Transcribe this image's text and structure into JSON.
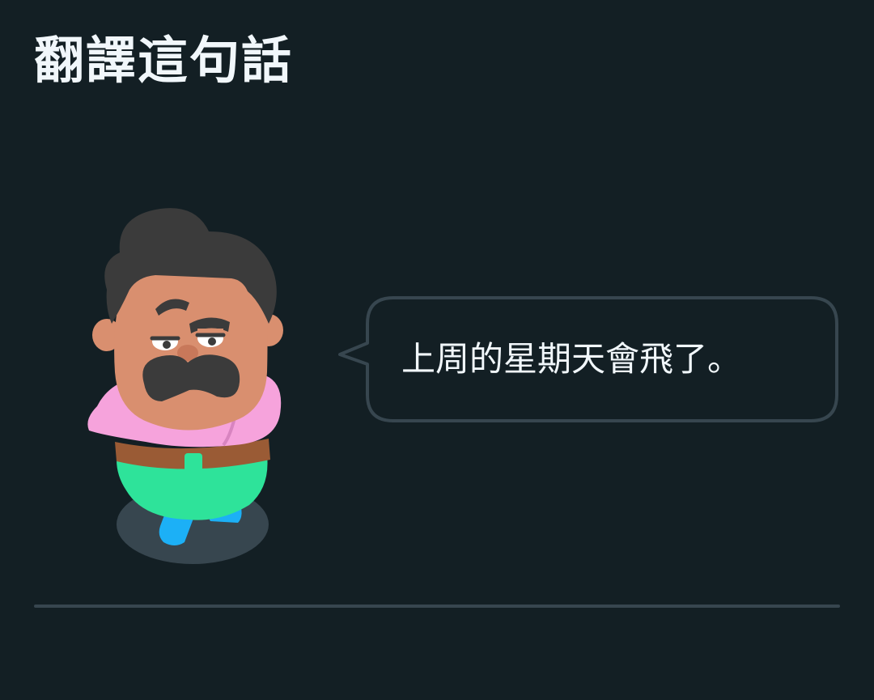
{
  "challenge": {
    "title": "翻譯這句話"
  },
  "prompt": {
    "sentence": "上周的星期天會飛了。"
  },
  "colors": {
    "background": "#131f24",
    "text": "#f1f7fb",
    "bubble_border": "#37464f",
    "divider": "#37464f",
    "skin": "#d98f6f",
    "hair": "#3b3b3b",
    "shirt": "#f6a3dc",
    "pants": "#2ee39a",
    "shoes": "#1cb0f6",
    "belt": "#9a5b35",
    "shadow": "#37464f"
  },
  "icons": {
    "character": "man-with-mustache-character",
    "speech_bubble": "speech-bubble"
  }
}
